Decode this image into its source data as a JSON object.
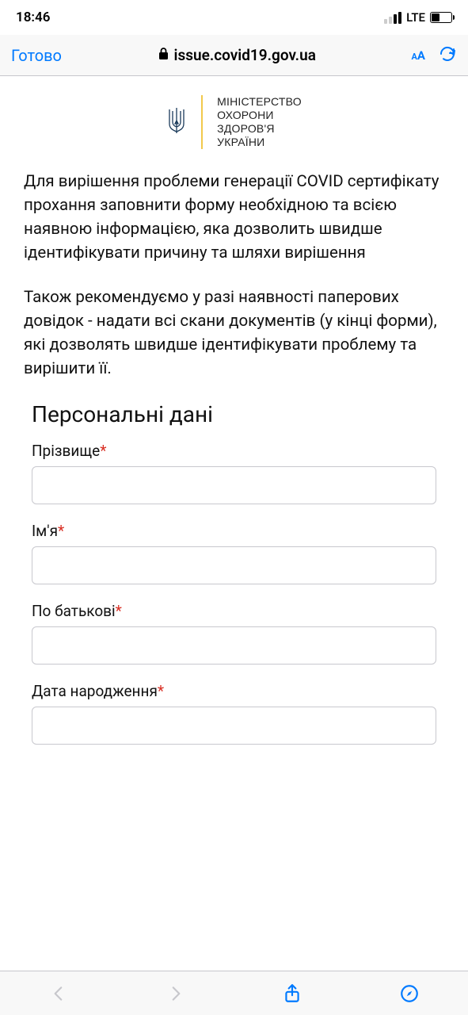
{
  "statusbar": {
    "time": "18:46",
    "network": "LTE"
  },
  "navbar": {
    "done": "Готово",
    "url": "issue.covid19.gov.ua"
  },
  "header": {
    "ministry_line1": "МІНІСТЕРСТВО",
    "ministry_line2": "ОХОРОНИ",
    "ministry_line3": "ЗДОРОВ'Я",
    "ministry_line4": "УКРАЇНИ"
  },
  "content": {
    "intro_p1": "Для вирішення проблеми генерації COVID сертифікату прохання заповнити форму необхідною та всією наявною інформацією, яка дозволить швидше ідентифікувати причину та шляхи вирішення",
    "intro_p2": "Також рекомендуємо у разі наявності паперових довідок - надати всі скани документів (у кінці форми), які дозволять швидше ідентифікувати проблему та вирішити її.",
    "section_title": "Персональні дані"
  },
  "form": {
    "surname": {
      "label": "Прізвище",
      "value": ""
    },
    "name": {
      "label": "Ім'я",
      "value": ""
    },
    "patronymic": {
      "label": "По батькові",
      "value": ""
    },
    "dob": {
      "label": "Дата народження",
      "value": ""
    }
  }
}
